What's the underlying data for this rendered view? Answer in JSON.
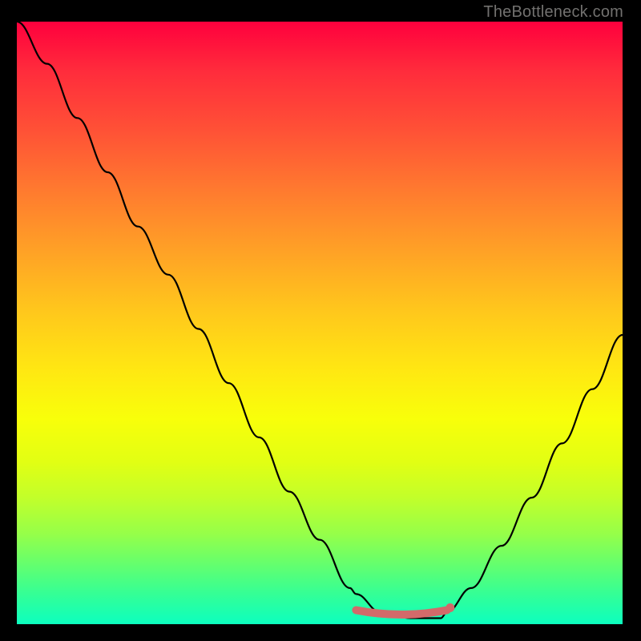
{
  "attribution": "TheBottleneck.com",
  "colors": {
    "curve": "#000000",
    "highlight": "#d26a6a",
    "frame_bg": "#000000"
  },
  "chart_data": {
    "type": "line",
    "title": "",
    "xlabel": "",
    "ylabel": "",
    "xlim": [
      0,
      100
    ],
    "ylim": [
      0,
      100
    ],
    "grid": false,
    "legend": false,
    "series": [
      {
        "name": "bottleneck-curve",
        "x": [
          0,
          5,
          10,
          15,
          20,
          25,
          30,
          35,
          40,
          45,
          50,
          55,
          56,
          60,
          65,
          70,
          71,
          75,
          80,
          85,
          90,
          95,
          100
        ],
        "y": [
          100,
          93,
          84,
          75,
          66,
          58,
          49,
          40,
          31,
          22,
          14,
          6,
          5,
          2,
          1,
          1,
          2,
          6,
          13,
          21,
          30,
          39,
          48
        ]
      }
    ],
    "annotations": [
      {
        "name": "optimal-range",
        "x_start": 56,
        "x_end": 71,
        "y": 1
      }
    ]
  }
}
